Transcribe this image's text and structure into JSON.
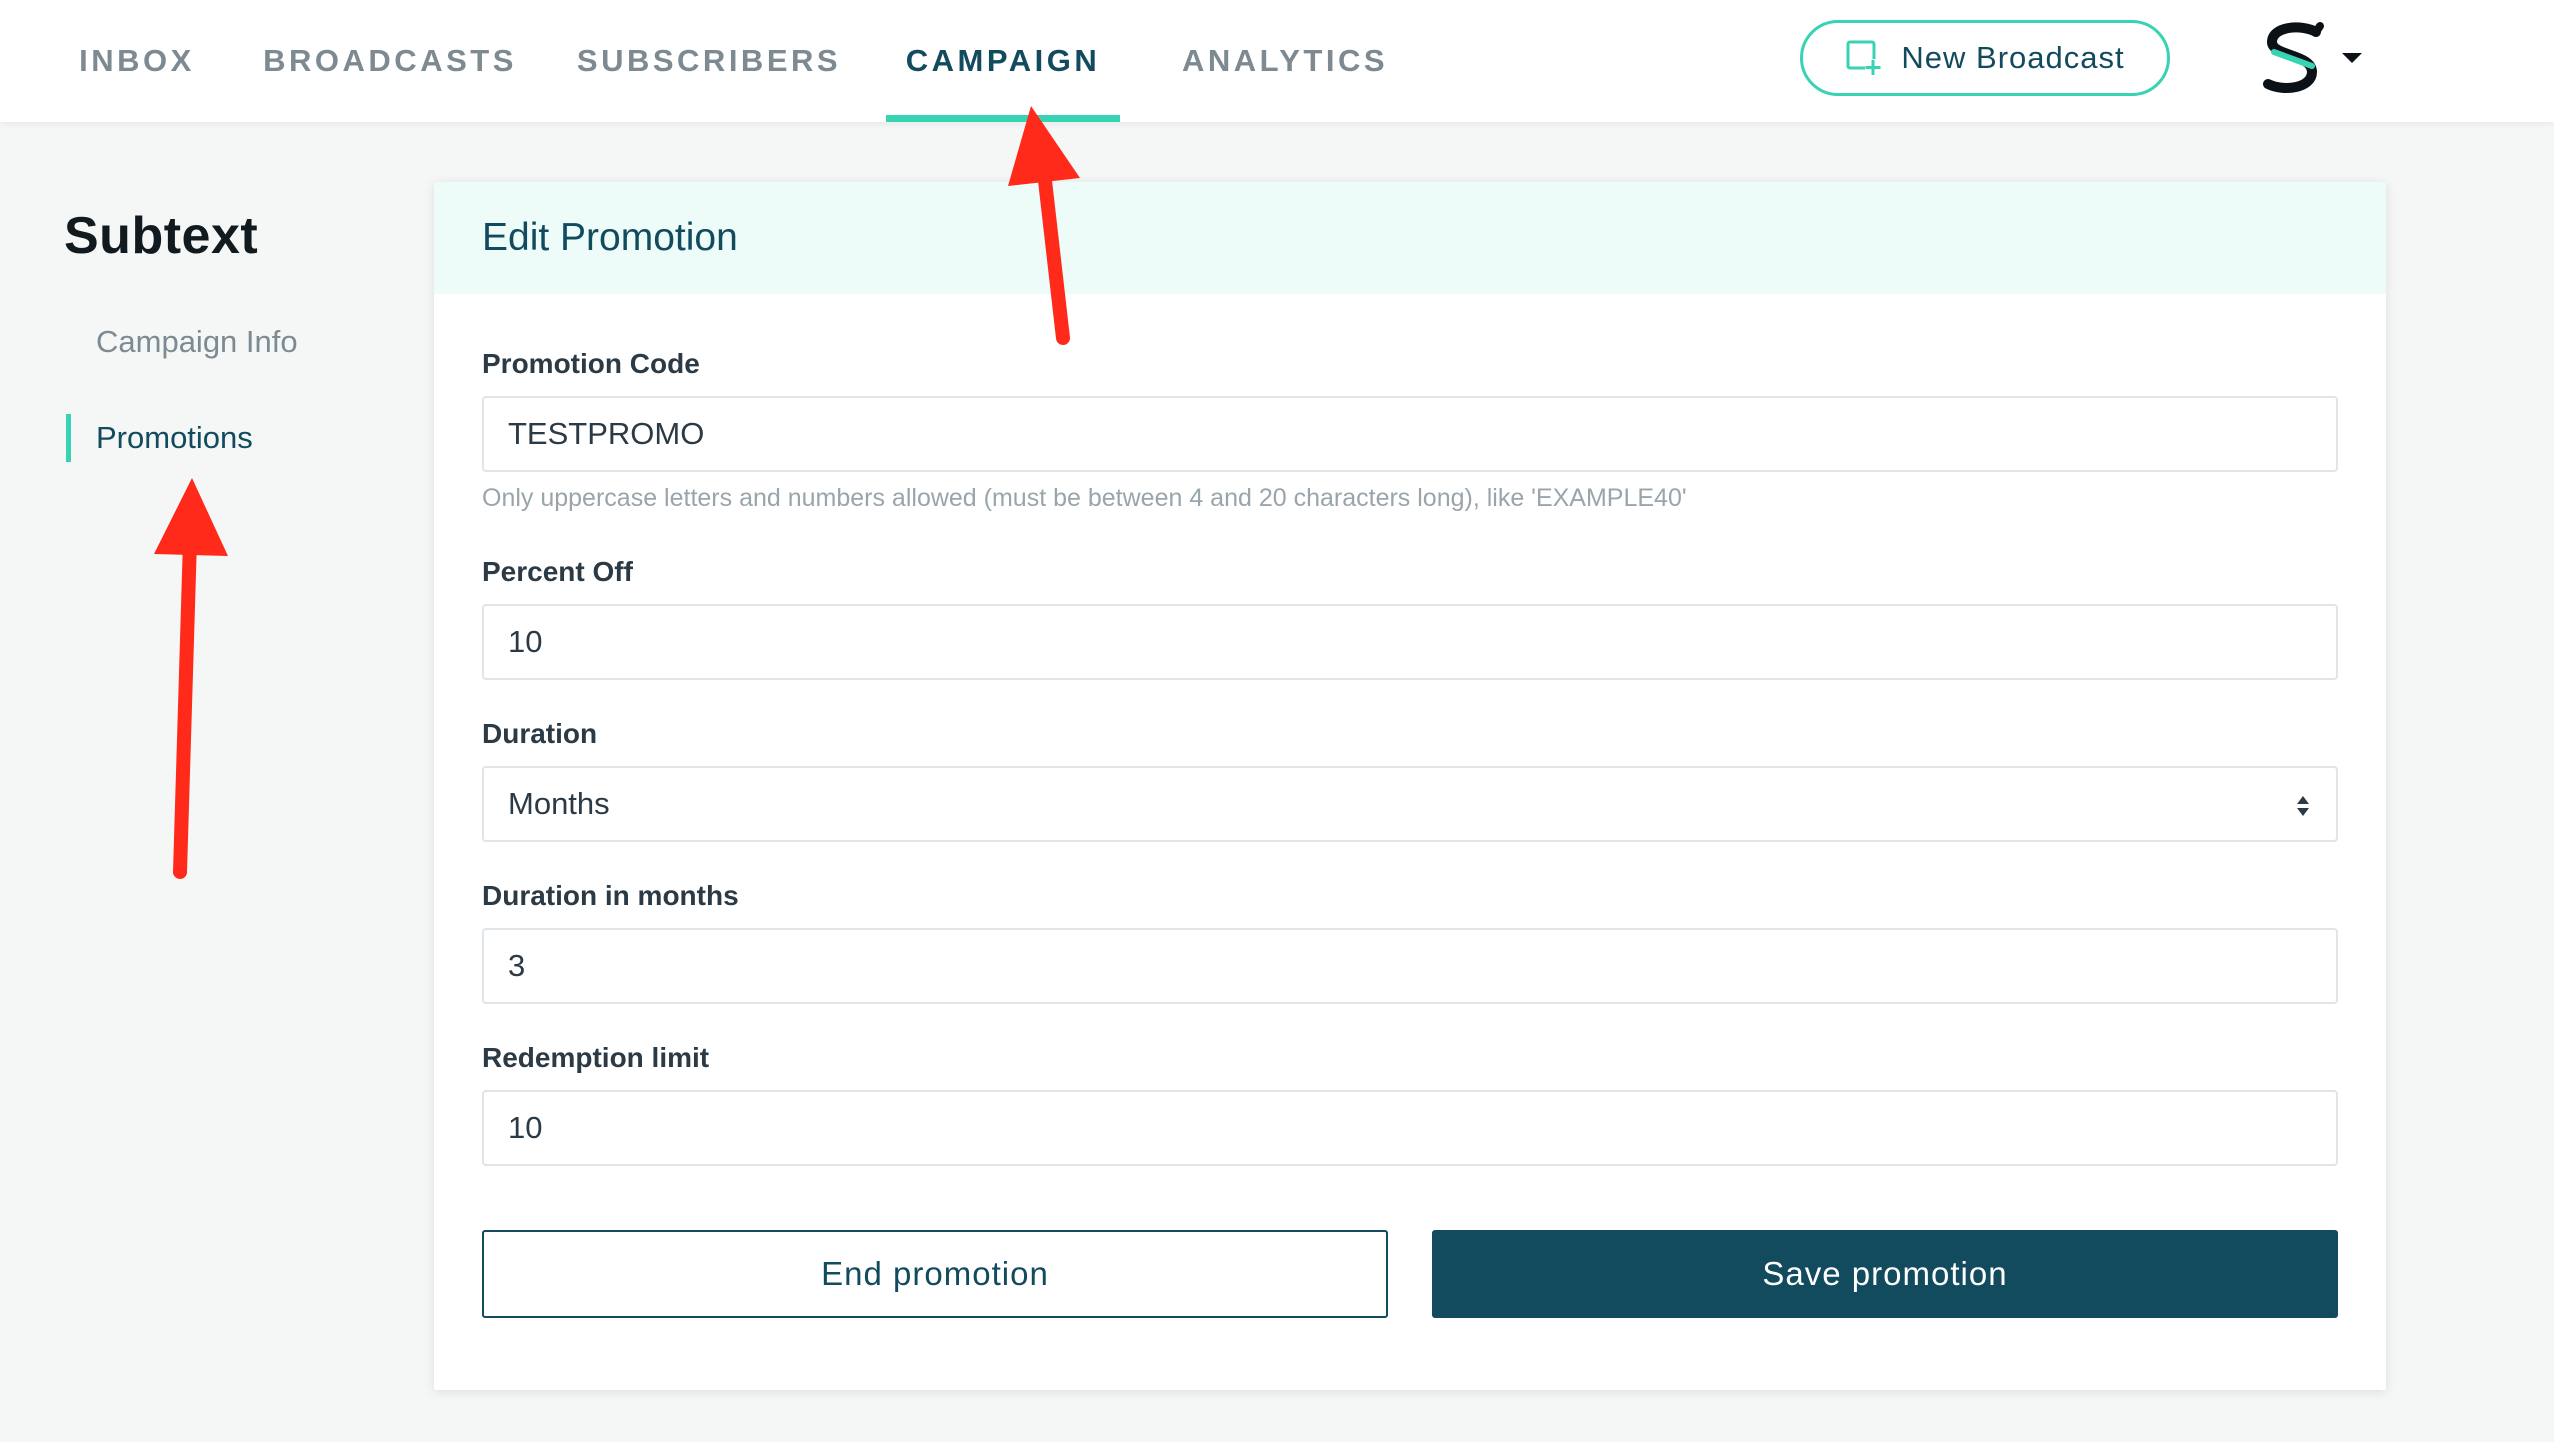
{
  "nav": {
    "tabs": [
      {
        "label": "INBOX"
      },
      {
        "label": "BROADCASTS"
      },
      {
        "label": "SUBSCRIBERS"
      },
      {
        "label": "CAMPAIGN",
        "active": true
      },
      {
        "label": "ANALYTICS"
      }
    ],
    "new_broadcast_label": "New Broadcast"
  },
  "sidebar": {
    "brand": "Subtext",
    "items": [
      {
        "label": "Campaign Info"
      },
      {
        "label": "Promotions",
        "active": true
      }
    ]
  },
  "form": {
    "title": "Edit Promotion",
    "promotion_code": {
      "label": "Promotion Code",
      "value": "TESTPROMO",
      "help": "Only uppercase letters and numbers allowed (must be between 4 and 20 characters long), like 'EXAMPLE40'"
    },
    "percent_off": {
      "label": "Percent Off",
      "value": "10"
    },
    "duration": {
      "label": "Duration",
      "value": "Months"
    },
    "duration_months": {
      "label": "Duration in months",
      "value": "3"
    },
    "redemption_limit": {
      "label": "Redemption limit",
      "value": "10"
    },
    "end_label": "End promotion",
    "save_label": "Save promotion"
  },
  "colors": {
    "accent": "#37d3b3",
    "primary": "#124a5e",
    "annotation": "#ff2a1a"
  },
  "icons": {
    "new_broadcast": "new-broadcast-icon",
    "logo": "subtext-logo-icon",
    "caret": "caret-down-icon",
    "select": "select-arrows-icon"
  }
}
